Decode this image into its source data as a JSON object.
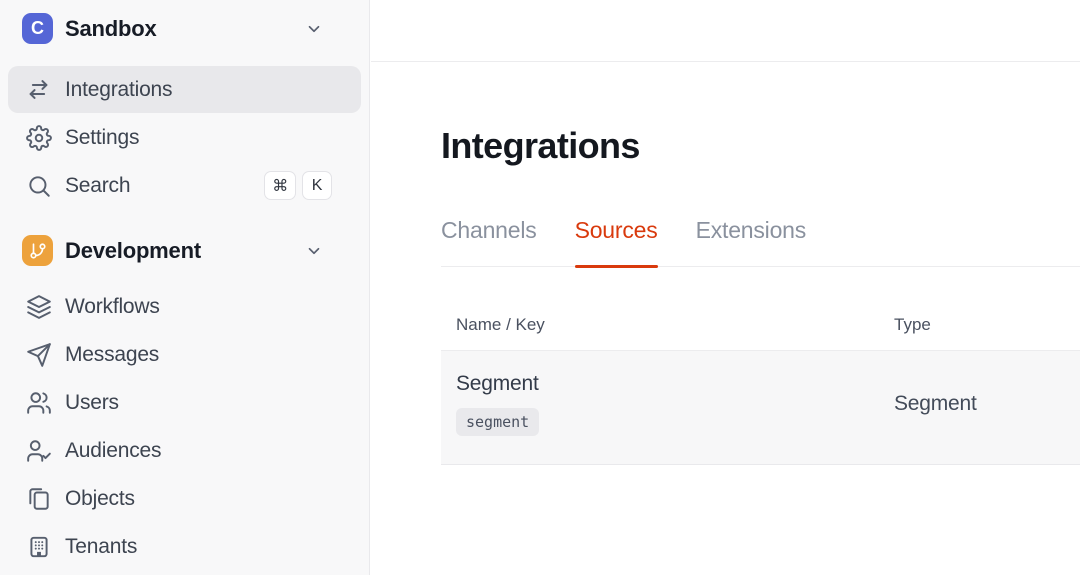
{
  "sidebar": {
    "workspace": {
      "name": "Sandbox",
      "logo_letter": "C"
    },
    "items_top": [
      {
        "label": "Integrations",
        "icon": "swap-arrows-icon",
        "active": true
      },
      {
        "label": "Settings",
        "icon": "gear-icon",
        "active": false
      },
      {
        "label": "Search",
        "icon": "search-icon",
        "active": false,
        "shortcut": [
          "⌘",
          "K"
        ]
      }
    ],
    "section": {
      "name": "Development",
      "icon": "git-branch-icon"
    },
    "items_dev": [
      {
        "label": "Workflows",
        "icon": "layers-icon"
      },
      {
        "label": "Messages",
        "icon": "paper-plane-icon"
      },
      {
        "label": "Users",
        "icon": "users-icon"
      },
      {
        "label": "Audiences",
        "icon": "user-check-icon"
      },
      {
        "label": "Objects",
        "icon": "copy-icon"
      },
      {
        "label": "Tenants",
        "icon": "building-icon"
      }
    ]
  },
  "main": {
    "title": "Integrations",
    "tabs": [
      {
        "label": "Channels",
        "active": false
      },
      {
        "label": "Sources",
        "active": true
      },
      {
        "label": "Extensions",
        "active": false
      }
    ],
    "table": {
      "columns": [
        "Name / Key",
        "Type"
      ],
      "rows": [
        {
          "name": "Segment",
          "key": "segment",
          "type": "Segment"
        }
      ]
    }
  },
  "colors": {
    "accent_red": "#d93a0d",
    "logo_indigo": "#5566d6",
    "dev_orange": "#eda23c",
    "sidebar_bg": "#f8f8f9",
    "active_item_bg": "#e8e8eb",
    "row_bg": "#f7f7f8"
  }
}
